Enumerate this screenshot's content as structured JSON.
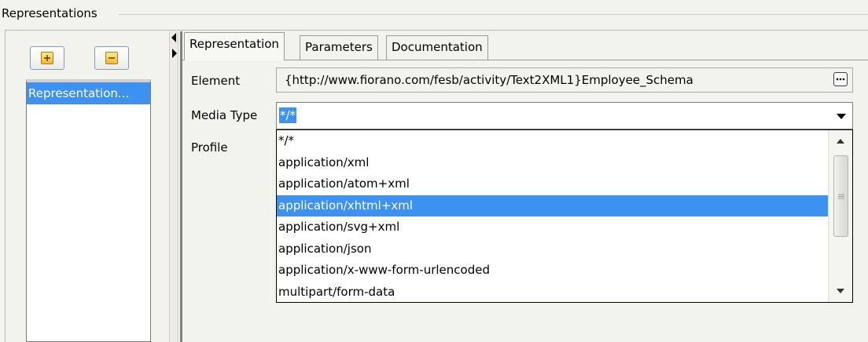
{
  "group": {
    "title": "Representations"
  },
  "toolbar": {
    "add_icon": "plus-icon",
    "remove_icon": "minus-icon"
  },
  "representations_list": {
    "items": [
      "Representation..."
    ]
  },
  "tabs": [
    {
      "label": "Representation",
      "active": true
    },
    {
      "label": "Parameters",
      "active": false
    },
    {
      "label": "Documentation",
      "active": false
    }
  ],
  "form": {
    "element_label": "Element",
    "element_value": "{http://www.fiorano.com/fesb/activity/Text2XML1}Employee_Schema",
    "media_type_label": "Media Type",
    "media_type_value": "*/*",
    "profile_label": "Profile"
  },
  "media_type_options": [
    "*/*",
    "application/xml",
    "application/atom+xml",
    "application/xhtml+xml",
    "application/svg+xml",
    "application/json",
    "application/x-www-form-urlencoded",
    "multipart/form-data"
  ],
  "highlighted_option": "application/xhtml+xml",
  "colors": {
    "selection": "#3d91f0",
    "background": "#f3f3ee"
  }
}
